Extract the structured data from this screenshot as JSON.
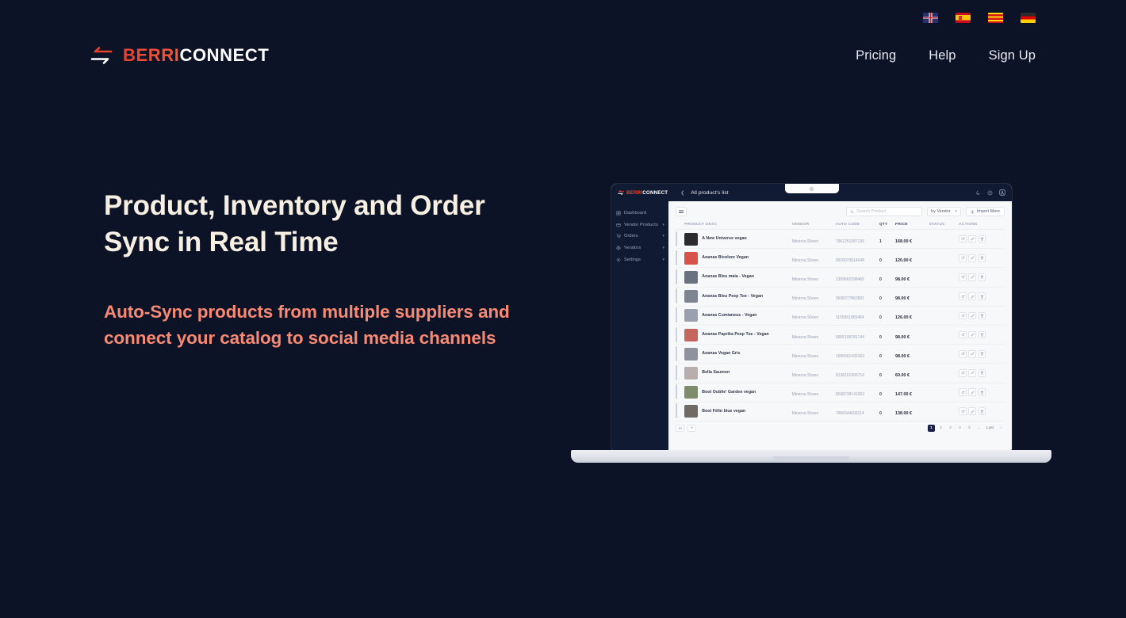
{
  "site": {
    "background_color": "#0c1326",
    "accent_color": "#e8422f",
    "heading_color": "#f6efe2",
    "subheading_color": "#f88a73"
  },
  "language_bar": {
    "languages": [
      {
        "name": "english",
        "icon": "flag-uk-icon"
      },
      {
        "name": "spanish",
        "icon": "flag-spain-icon"
      },
      {
        "name": "catalan",
        "icon": "flag-catalonia-icon"
      },
      {
        "name": "german",
        "icon": "flag-germany-icon"
      }
    ]
  },
  "header": {
    "logo": {
      "icon": "sync-arrows-icon",
      "primary": "BERRI",
      "secondary": "CONNECT"
    },
    "nav": [
      {
        "label": "Pricing"
      },
      {
        "label": "Help"
      },
      {
        "label": "Sign Up"
      }
    ]
  },
  "hero": {
    "title": "Product, Inventory and Order Sync in Real Time",
    "subtitle": "Auto-Sync products from multiple suppliers and connect your catalog to social media channels"
  },
  "app_mockup": {
    "topbar": {
      "logo_primary": "BERRI",
      "logo_secondary": "CONNECT",
      "collapse_icon": "chevron-left-icon",
      "breadcrumb": "All product's list",
      "icons": [
        "bell-icon",
        "help-circle-icon",
        "user-account-icon"
      ]
    },
    "sidebar": {
      "items": [
        {
          "label": "Dashboard",
          "icon": "dashboard-icon",
          "expandable": false
        },
        {
          "label": "Vendor Products",
          "icon": "box-icon",
          "expandable": true
        },
        {
          "label": "Orders",
          "icon": "cart-icon",
          "expandable": true
        },
        {
          "label": "Vendors",
          "icon": "store-icon",
          "expandable": true
        },
        {
          "label": "Settings",
          "icon": "gear-icon",
          "expandable": true
        }
      ]
    },
    "toolbar": {
      "grid_view_icon": "list-view-icon",
      "search_placeholder": "Search Product",
      "search_icon": "search-icon",
      "filter_value": "by Vendor",
      "filter_caret": "chevron-down-icon",
      "import_label": "Import More",
      "import_icon": "upload-icon"
    },
    "table": {
      "columns": [
        {
          "label": "PRODUCT DESC",
          "strong": false
        },
        {
          "label": "VENDOR",
          "strong": false
        },
        {
          "label": "AUTO CODE",
          "strong": false
        },
        {
          "label": "QTY",
          "strong": true
        },
        {
          "label": "PRICE",
          "strong": true
        },
        {
          "label": "STATUS",
          "strong": false
        },
        {
          "label": "ACTIONS",
          "strong": false
        }
      ],
      "rows": [
        {
          "name": "A New Universe vegan",
          "vendor": "Minerva Shoes",
          "code": "7961251087136",
          "qty": "1",
          "price": "168.00 €",
          "status": "",
          "thumb": "#2b2b30"
        },
        {
          "name": "Ananas Bicolore Vegan",
          "vendor": "Minerva Shoes",
          "code": "9916073614648",
          "qty": "0",
          "price": "120.00 €",
          "status": "",
          "thumb": "#d8524a"
        },
        {
          "name": "Ananas Bleu maia - Vegan",
          "vendor": "Minerva Shoes",
          "code": "1309661598465",
          "qty": "0",
          "price": "98.00 €",
          "status": "",
          "thumb": "#6b7180"
        },
        {
          "name": "Ananas Bleu Peep Toe - Vegan",
          "vendor": "Minerva Shoes",
          "code": "9938277862831",
          "qty": "0",
          "price": "98.00 €",
          "status": "",
          "thumb": "#7d8591"
        },
        {
          "name": "Ananas Cumianeus - Vegan",
          "vendor": "Minerva Shoes",
          "code": "1109361865484",
          "qty": "0",
          "price": "126.00 €",
          "status": "",
          "thumb": "#9aa0ad"
        },
        {
          "name": "Ananas Paprika Peep Toe - Vegan",
          "vendor": "Minerva Shoes",
          "code": "5955109781744",
          "qty": "0",
          "price": "98.00 €",
          "status": "",
          "thumb": "#c6655e"
        },
        {
          "name": "Ananas Vegan Gris",
          "vendor": "Minerva Shoes",
          "code": "1005551433163",
          "qty": "0",
          "price": "98.00 €",
          "status": "",
          "thumb": "#8d929d"
        },
        {
          "name": "Bella Saumon",
          "vendor": "Minerva Shoes",
          "code": "9138151006716",
          "qty": "0",
          "price": "60.00 €",
          "status": "",
          "thumb": "#b9aeae"
        },
        {
          "name": "Boot Oublie' Garden vegan",
          "vendor": "Minerva Shoes",
          "code": "8038738141362",
          "qty": "0",
          "price": "147.00 €",
          "status": "",
          "thumb": "#7e8c6b"
        },
        {
          "name": "Boot Félin blue vegan",
          "vendor": "Minerva Shoes",
          "code": "7956544606114",
          "qty": "0",
          "price": "138.00 €",
          "status": "",
          "thumb": "#6f6a66"
        }
      ]
    },
    "footer": {
      "rows_value": "10",
      "rows_caret": "chevron-down-icon",
      "pages": [
        "1",
        "2",
        "3",
        "4",
        "5",
        "...",
        "Last",
        "›"
      ],
      "active_page": "1"
    }
  }
}
